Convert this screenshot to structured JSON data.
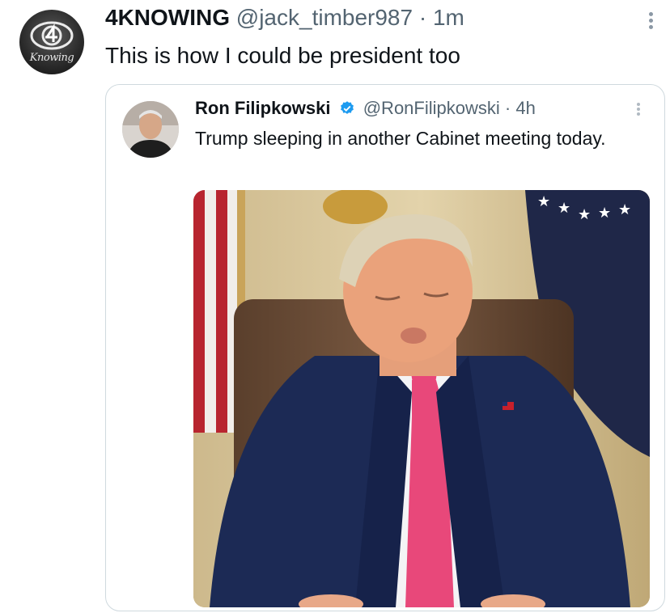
{
  "post": {
    "author_name": "4KNOWING",
    "handle": "@jack_timber987",
    "separator": "·",
    "time": "1m",
    "text": "This is how I could be president too",
    "avatar_logo_text": "Knowing"
  },
  "quoted_post": {
    "author_name": "Ron Filipkowski",
    "handle": "@RonFilipkowski",
    "separator": "·",
    "time": "4h",
    "text": "Trump sleeping in another Cabinet meeting today."
  },
  "icons": {
    "more": "more-options-icon",
    "verified": "verified-badge-icon"
  },
  "colors": {
    "text": "#0f1419",
    "secondary": "#536471",
    "verified": "#1d9bf0",
    "tie": "#e8487a",
    "suit": "#1c2a55"
  }
}
